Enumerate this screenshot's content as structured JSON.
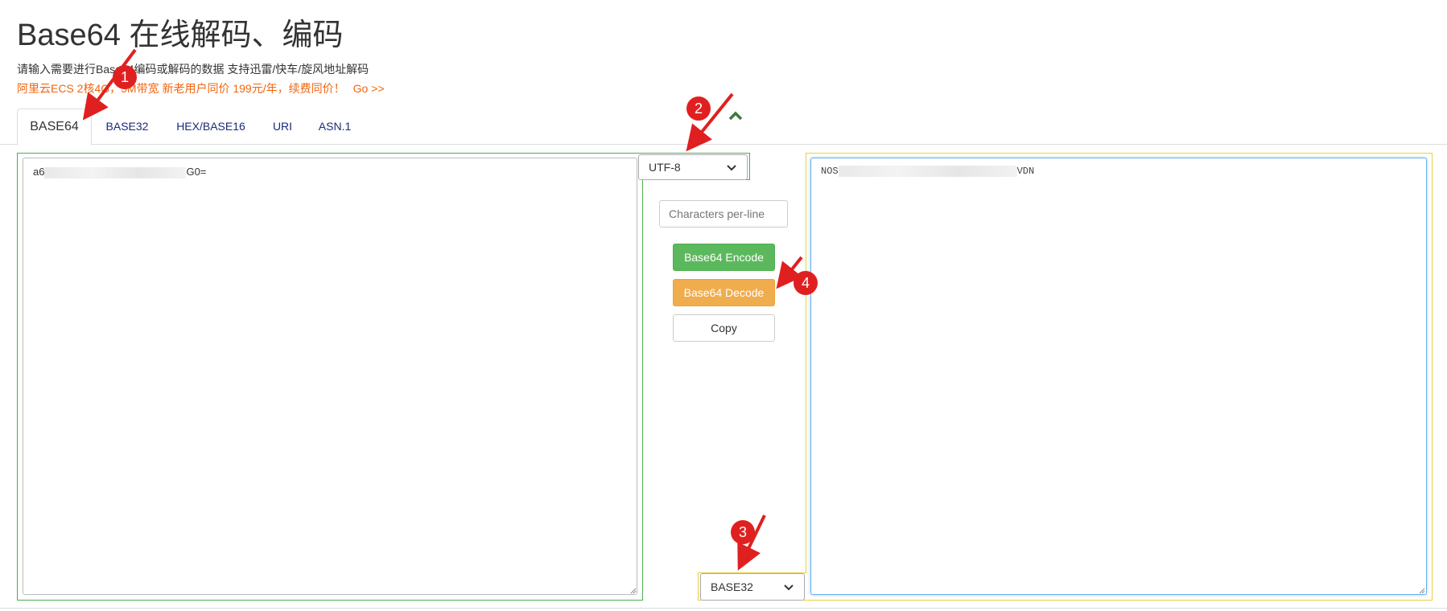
{
  "header": {
    "title": "Base64 在线解码、编码",
    "subtitle": "请输入需要进行Base64编码或解码的数据 支持迅雷/快车/旋风地址解码",
    "promo_text": "阿里云ECS 2核4G，5M带宽 新老用户同价 199元/年，续费同价！",
    "promo_link": "Go >>"
  },
  "tabs": [
    {
      "label": "BASE64",
      "active": true
    },
    {
      "label": "BASE32",
      "active": false
    },
    {
      "label": "HEX/BASE16",
      "active": false
    },
    {
      "label": "URI",
      "active": false
    },
    {
      "label": "ASN.1",
      "active": false
    }
  ],
  "input": {
    "value_start": "a6",
    "value_end": "G0="
  },
  "controls": {
    "charset": "UTF-8",
    "chars_per_line_placeholder": "Characters per-line",
    "encode_label": "Base64 Encode",
    "decode_label": "Base64 Decode",
    "copy_label": "Copy",
    "output_format": "BASE32"
  },
  "output": {
    "value_start": "NOS",
    "value_end": "VDN"
  },
  "annotations": {
    "markers": [
      "1",
      "2",
      "3",
      "4"
    ]
  },
  "colors": {
    "promo": "#f0650e",
    "encode": "#5cb85c",
    "decode": "#f0ad4e",
    "marker": "#e02020",
    "green_border": "#4cae4c",
    "yellow_border": "#eed03b",
    "collapse_icon": "#3c7a3c"
  },
  "icons": {
    "collapse": "chevron-up-icon",
    "select_caret": "chevron-down-icon"
  }
}
